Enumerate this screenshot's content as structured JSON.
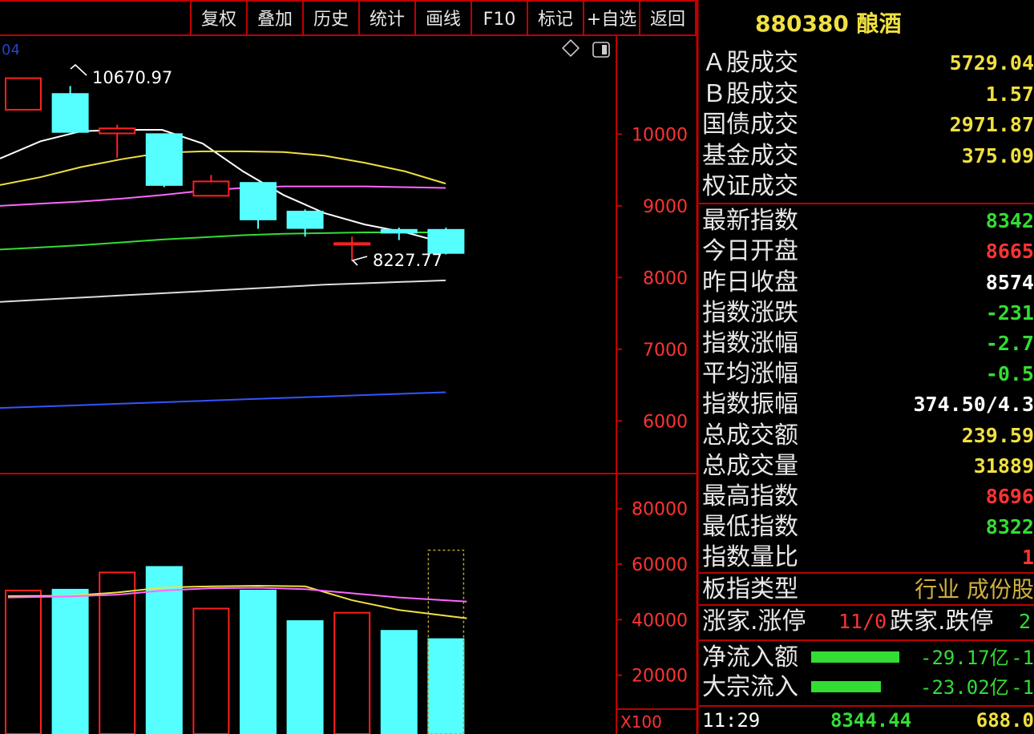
{
  "toolbar": {
    "buttons": [
      "复权",
      "叠加",
      "历史",
      "统计",
      "画线",
      "F10",
      "标记",
      "+自选",
      "返回"
    ]
  },
  "main_chart": {
    "top_left_label": "04",
    "high_label": "10670.97",
    "low_label": "8227.77",
    "price_axis": [
      "10000",
      "9000",
      "8000",
      "7000",
      "6000"
    ],
    "volume_axis": [
      "80000",
      "60000",
      "40000",
      "20000"
    ],
    "volume_unit": "X100"
  },
  "chart_data": {
    "type": "candlestick",
    "candles": [
      {
        "open": 10340,
        "close": 10780,
        "high": 10780,
        "low": 10340,
        "direction": "up"
      },
      {
        "open": 10560,
        "close": 10030,
        "high": 10670.97,
        "low": 10030,
        "direction": "down"
      },
      {
        "open": 10010,
        "close": 10080,
        "high": 10130,
        "low": 9670,
        "direction": "up"
      },
      {
        "open": 10000,
        "close": 9290,
        "high": 10000,
        "low": 9260,
        "direction": "down"
      },
      {
        "open": 9140,
        "close": 9340,
        "high": 9430,
        "low": 9130,
        "direction": "up"
      },
      {
        "open": 9320,
        "close": 8810,
        "high": 9330,
        "low": 8680,
        "direction": "down"
      },
      {
        "open": 8920,
        "close": 8690,
        "high": 8950,
        "low": 8570,
        "direction": "down"
      },
      {
        "open": 8470,
        "close": 8480,
        "high": 8570,
        "low": 8227.77,
        "direction": "up"
      },
      {
        "open": 8665,
        "close": 8625,
        "high": 8696,
        "low": 8522,
        "direction": "down"
      },
      {
        "open": 8665,
        "close": 8342,
        "high": 8696,
        "low": 8322,
        "direction": "down"
      }
    ],
    "ma_lines": [
      {
        "color": "#ffffff",
        "values": [
          9660,
          9900,
          10040,
          10060,
          10060,
          9870,
          9480,
          9150,
          8900,
          8740,
          8630,
          8480
        ]
      },
      {
        "color": "#f0e040",
        "values": [
          9290,
          9400,
          9540,
          9650,
          9740,
          9760,
          9760,
          9750,
          9700,
          9600,
          9480,
          9310
        ]
      },
      {
        "color": "#ff66ff",
        "values": [
          9000,
          9030,
          9060,
          9100,
          9150,
          9210,
          9250,
          9270,
          9270,
          9270,
          9260,
          9250
        ]
      },
      {
        "color": "#33dd33",
        "values": [
          8390,
          8420,
          8450,
          8490,
          8530,
          8560,
          8590,
          8610,
          8620,
          8630,
          8630,
          8630
        ]
      },
      {
        "color": "#dddddd",
        "values": [
          7660,
          7690,
          7720,
          7750,
          7780,
          7810,
          7840,
          7870,
          7900,
          7920,
          7940,
          7960
        ]
      },
      {
        "color": "#3355ff",
        "values": [
          6180,
          6200,
          6220,
          6240,
          6260,
          6280,
          6300,
          6320,
          6340,
          6360,
          6380,
          6400
        ]
      }
    ],
    "volume": [
      {
        "value": 50500,
        "direction": "up"
      },
      {
        "value": 50800,
        "direction": "down"
      },
      {
        "value": 57000,
        "direction": "up"
      },
      {
        "value": 59000,
        "direction": "down"
      },
      {
        "value": 44000,
        "direction": "up"
      },
      {
        "value": 50500,
        "direction": "down"
      },
      {
        "value": 39500,
        "direction": "down"
      },
      {
        "value": 42500,
        "direction": "up"
      },
      {
        "value": 36000,
        "direction": "down"
      },
      {
        "value": 33000,
        "direction": "down"
      }
    ],
    "volume_projection": 65000,
    "volume_ma": [
      {
        "color": "#f0e040",
        "values": [
          48500,
          48600,
          49800,
          51600,
          52000,
          52200,
          52000,
          47000,
          43500,
          40500
        ]
      },
      {
        "color": "#ff66ff",
        "values": [
          48000,
          48400,
          49000,
          50500,
          51300,
          51500,
          51000,
          49500,
          48000,
          46500
        ]
      }
    ],
    "price_ylim": [
      5500,
      11200
    ],
    "volume_ylim": [
      0,
      90000
    ]
  },
  "panel": {
    "title": "880380 酿酒",
    "rows": [
      {
        "label": "Ａ股成交",
        "value": "5729.04",
        "color": "#f0e040"
      },
      {
        "label": "Ｂ股成交",
        "value": "1.57",
        "color": "#f0e040"
      },
      {
        "label": "国债成交",
        "value": "2971.87",
        "color": "#f0e040"
      },
      {
        "label": "基金成交",
        "value": "375.09",
        "color": "#f0e040"
      },
      {
        "label": "权证成交",
        "value": "",
        "color": "#f0e040"
      },
      {
        "label": "最新指数",
        "value": "8342",
        "color": "#33dd33"
      },
      {
        "label": "今日开盘",
        "value": "8665",
        "color": "#ff3333"
      },
      {
        "label": "昨日收盘",
        "value": "8574",
        "color": "#ffffff"
      },
      {
        "label": "指数涨跌",
        "value": "-231",
        "color": "#33dd33"
      },
      {
        "label": "指数涨幅",
        "value": "-2.7",
        "color": "#33dd33"
      },
      {
        "label": "平均涨幅",
        "value": "-0.5",
        "color": "#33dd33"
      },
      {
        "label": "指数振幅",
        "value": "374.50/4.3",
        "color": "#ffffff"
      },
      {
        "label": "总成交额",
        "value": "239.59",
        "color": "#f0e040"
      },
      {
        "label": "总成交量",
        "value": "31889",
        "color": "#f0e040"
      },
      {
        "label": "最高指数",
        "value": "8696",
        "color": "#ff3333"
      },
      {
        "label": "最低指数",
        "value": "8322",
        "color": "#33dd33"
      },
      {
        "label": "指数量比",
        "value": "1",
        "color": "#ff3333"
      },
      {
        "label": "板指类型",
        "value": "行业 成份股",
        "color": "#d0b040"
      }
    ],
    "breadth": {
      "up_label": "涨家.涨停",
      "up_value": "11/0",
      "down_label": "跌家.跌停",
      "down_value": "2"
    },
    "flows": [
      {
        "label": "净流入额",
        "value": "-29.17亿",
        "extra": "-1",
        "bar_fraction": 1.0,
        "color": "#33dd33"
      },
      {
        "label": "大宗流入",
        "value": "-23.02亿",
        "extra": "-1",
        "bar_fraction": 0.79,
        "color": "#33dd33"
      }
    ],
    "tick": {
      "time": "11:29",
      "price": "8344.44",
      "volume": "688.0"
    }
  }
}
